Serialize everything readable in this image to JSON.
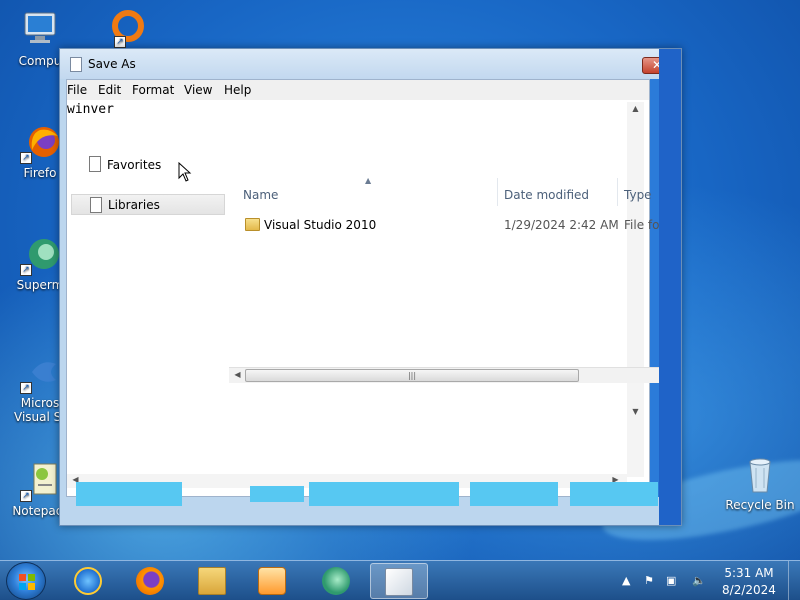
{
  "desktop": {
    "icons": [
      {
        "label": "Compu"
      },
      {
        "label": ""
      },
      {
        "label": "Firefo"
      },
      {
        "label": "Superm"
      },
      {
        "label": "Micros"
      },
      {
        "label": "Visual St"
      },
      {
        "label": "Notepad-"
      },
      {
        "label": "Recycle Bin"
      }
    ]
  },
  "window": {
    "title": "Save As",
    "close_label": "✕",
    "menu": [
      "File",
      "Edit",
      "Format",
      "View",
      "Help"
    ],
    "document_text": "winver",
    "nav": {
      "favorites": "Favorites",
      "libraries": "Libraries"
    },
    "columns": [
      "Name",
      "Date modified",
      "Type"
    ],
    "rows": [
      {
        "name": "Visual Studio 2010",
        "date": "1/29/2024 2:42 AM",
        "type": "File folder"
      }
    ]
  },
  "taskbar": {
    "time": "5:31 AM",
    "date": "8/2/2024"
  },
  "colors": {
    "accent_bar": "#57c8f2",
    "close_button": "#c4422d"
  }
}
